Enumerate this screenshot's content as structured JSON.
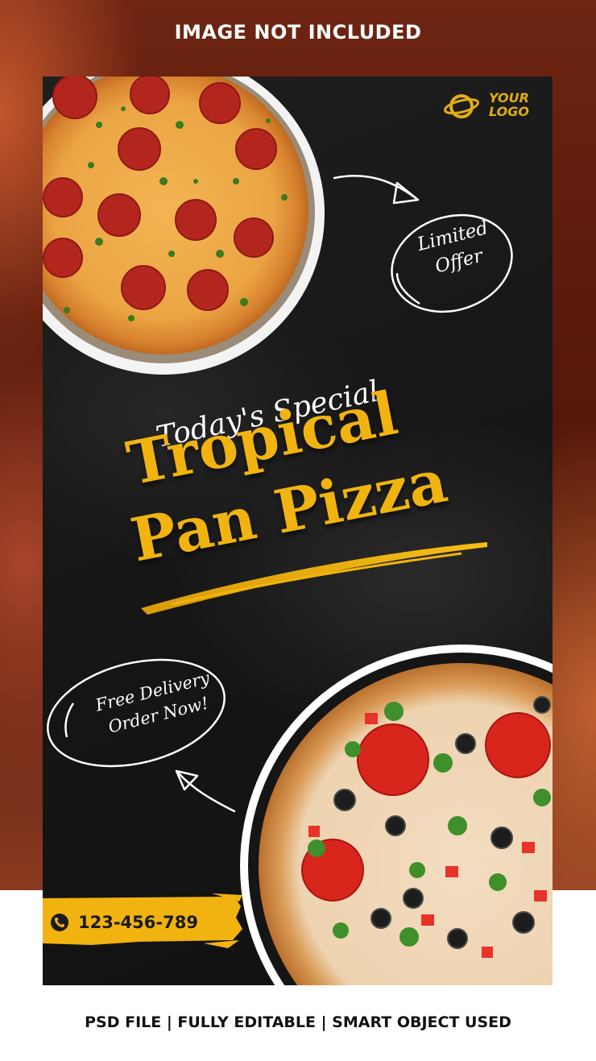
{
  "captions": {
    "top": "IMAGE NOT INCLUDED",
    "bottom": "PSD FILE | FULLY EDITABLE | SMART OBJECT USED"
  },
  "logo": {
    "line1": "YOUR",
    "line2": "LOGO",
    "icon": "planet-ring-icon",
    "color": "#e2ad13"
  },
  "badges": {
    "limited_line1": "Limited",
    "limited_line2": "Offer",
    "delivery_line1": "Free Delivery",
    "delivery_line2": "Order Now!"
  },
  "headline": {
    "kicker": "Today's Special",
    "line1": "Tropical",
    "line2": "Pan Pizza",
    "accent": "#f1b30f"
  },
  "contact": {
    "phone": "123-456-789",
    "icon": "phone-icon",
    "accent": "#f1b30f"
  },
  "images": {
    "top_pizza": "pepperoni-pizza",
    "bottom_pizza": "vegetable-pizza"
  },
  "colors": {
    "poster_bg": "#161616",
    "backdrop": "#5a1a0c"
  }
}
